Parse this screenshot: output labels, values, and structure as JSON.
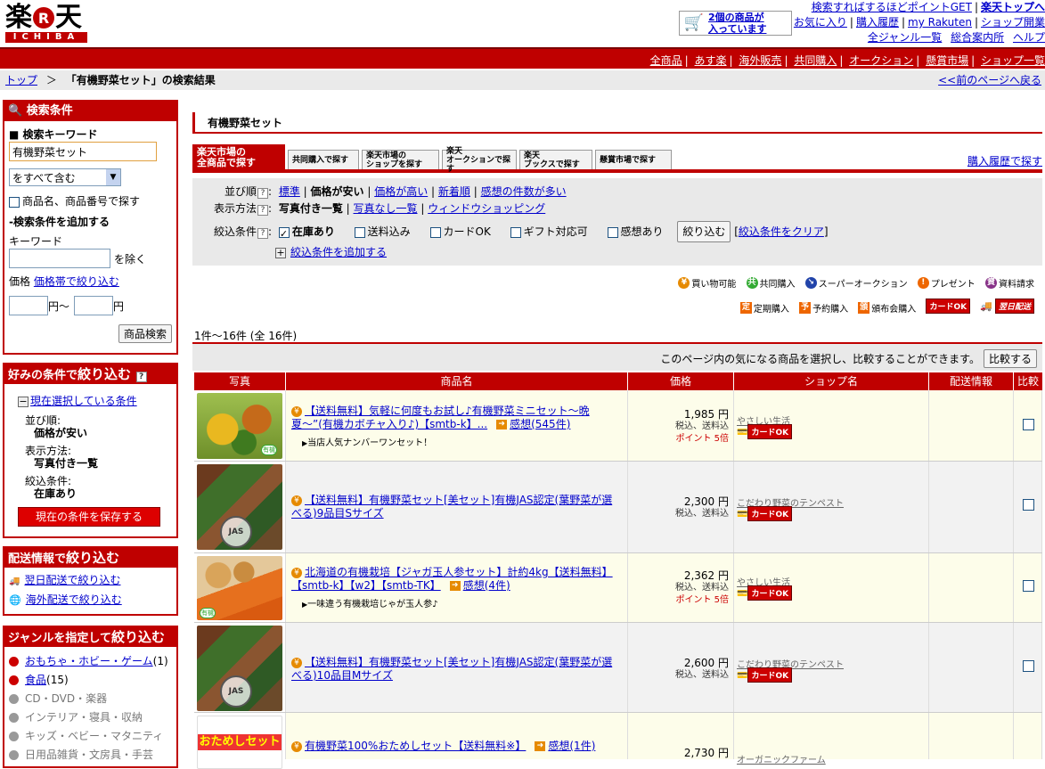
{
  "logo": {
    "left": "楽",
    "r": "R",
    "right": "天",
    "sub": "ICHIBA"
  },
  "cart": {
    "line1": "2個の商品が",
    "line2": "入っています"
  },
  "header_links": {
    "row1": [
      "検索すればするほどポイントGET",
      "楽天トップへ"
    ],
    "row2": [
      "お気に入り",
      "購入履歴",
      "my Rakuten",
      "ショップ開業"
    ],
    "row3": [
      "全ジャンル一覧",
      "総合案内所",
      "ヘルプ"
    ]
  },
  "redbar_links": [
    "全商品",
    "あす楽",
    "海外販売",
    "共同購入",
    "オークション",
    "懸賞市場",
    "ショップ一覧"
  ],
  "breadcrumb": {
    "top": "トップ",
    "sep": "＞",
    "current": "「有機野菜セット」の検索結果",
    "back": "<<前のページへ戻る"
  },
  "sidebar": {
    "search": {
      "header": "検索条件",
      "keyword_label": "■ 検索キーワード",
      "keyword_value": "有機野菜セット",
      "match_select": "をすべて含む",
      "name_only": "商品名、商品番号で探す",
      "add_cond": "-検索条件を追加する",
      "kw_label": "キーワード",
      "exclude": "を除く",
      "price_label": "価格",
      "price_link": "価格帯で絞り込む",
      "yen_from": "円〜",
      "yen_to": "円",
      "search_button": "商品検索"
    },
    "prefs": {
      "header_pre": "好みの条件で",
      "header_big": "絞り込む",
      "current_link": "現在選択している条件",
      "sort_label": "並び順:",
      "sort_value": "価格が安い",
      "display_label": "表示方法:",
      "display_value": "写真付き一覧",
      "filter_label": "絞込条件:",
      "filter_value": "在庫あり",
      "save_button": "現在の条件を保存する"
    },
    "shipping": {
      "header_pre": "配送情報で",
      "header_big": "絞り込む",
      "items": [
        "翌日配送で絞り込む",
        "海外配送で絞り込む"
      ]
    },
    "genre": {
      "header_pre": "ジャンルを指定して",
      "header_big": "絞り込む",
      "items": [
        {
          "label": "おもちゃ・ホビー・ゲーム",
          "count": "(1)"
        },
        {
          "label": "食品",
          "count": "(15)"
        },
        {
          "label": "CD・DVD・楽器",
          "count": ""
        },
        {
          "label": "インテリア・寝具・収納",
          "count": ""
        },
        {
          "label": "キッズ・ベビー・マタニティ",
          "count": ""
        },
        {
          "label": "日用品雑貨・文房具・手芸",
          "count": ""
        }
      ]
    }
  },
  "main": {
    "title": "有機野菜セット",
    "tabs": [
      {
        "l1": "楽天市場の",
        "l2": "全商品で探す"
      },
      {
        "l1": "共同購入で探す",
        "l2": ""
      },
      {
        "l1": "楽天市場の",
        "l2": "ショップを探す"
      },
      {
        "l1": "楽天",
        "l2": "オークションで探す"
      },
      {
        "l1": "楽天",
        "l2": "ブックスで探す"
      },
      {
        "l1": "懸賞市場で探す",
        "l2": ""
      }
    ],
    "history_link": "購入履歴で探す",
    "filter": {
      "sort_label": "並び順",
      "sort_options": [
        "標準",
        "価格が安い",
        "価格が高い",
        "新着順",
        "感想の件数が多い"
      ],
      "display_label": "表示方法",
      "display_options": [
        "写真付き一覧",
        "写真なし一覧",
        "ウィンドウショッピング"
      ],
      "cond_label": "絞込条件",
      "conds": [
        "在庫あり",
        "送料込み",
        "カードOK",
        "ギフト対応可",
        "感想あり"
      ],
      "apply_button": "絞り込む",
      "clear_link": "絞込条件をクリア",
      "add_link": "絞込条件を追加する"
    },
    "legend1": [
      "買い物可能",
      "共同購入",
      "スーパーオークション",
      "プレゼント",
      "資料請求"
    ],
    "legend2": [
      "定期購入",
      "予約購入",
      "頒布会購入",
      "カードOK",
      "翌日配送"
    ],
    "count_text": "1件〜16件 (全 16件)",
    "compare_text": "このページ内の気になる商品を選択し、比較することができます。",
    "compare_button": "比較する",
    "columns": [
      "写真",
      "商品名",
      "価格",
      "ショップ名",
      "配送情報",
      "比較"
    ],
    "products": [
      {
        "name": "【送料無料】気軽に何度もお試し♪有機野菜ミニセット〜晩夏〜”(有機カボチャ入り♪)【smtb-k】...",
        "reviews": "感想(545件)",
        "note": "当店人気ナンバーワンセット！",
        "price": "1,985 円",
        "tax": "税込、送料込",
        "point": "ポイント 5倍",
        "shop": "やさしい生活"
      },
      {
        "name": "【送料無料】有機野菜セット[美セット]有機JAS認定(葉野菜が選べる)9品目Sサイズ",
        "reviews": "",
        "note": "",
        "price": "2,300 円",
        "tax": "税込、送料込",
        "point": "",
        "shop": "こだわり野菜のテンペスト"
      },
      {
        "name": "北海道の有機栽培【ジャガ玉人参セット】計約4kg【送料無料】【smtb-k】【w2】【smtb-TK】",
        "reviews": "感想(4件)",
        "note": "一味違う有機栽培じゃが玉人参♪",
        "price": "2,362 円",
        "tax": "税込、送料込",
        "point": "ポイント 5倍",
        "shop": "やさしい生活"
      },
      {
        "name": "【送料無料】有機野菜セット[美セット]有機JAS認定(葉野菜が選べる)10品目Mサイズ",
        "reviews": "",
        "note": "",
        "price": "2,600 円",
        "tax": "税込、送料込",
        "point": "",
        "shop": "こだわり野菜のテンペスト"
      },
      {
        "name": "有機野菜100%おためしセット【送料無料※】",
        "reviews": "感想(1件)",
        "note": "",
        "price": "2,730 円",
        "tax": "",
        "point": "",
        "shop": "オーガニックファーム"
      }
    ],
    "thumb5_text": "おためしセット",
    "jas": "JAS",
    "org": "有機"
  }
}
